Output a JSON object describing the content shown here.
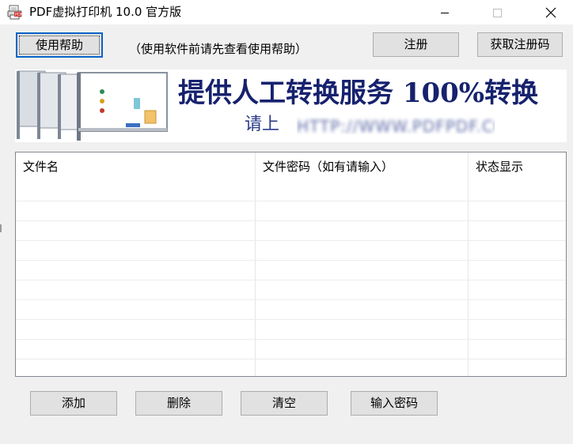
{
  "window": {
    "title": "PDF虚拟打印机 10.0 官方版",
    "app_icon": "pdf-printer-icon",
    "controls": [
      "minimize-icon",
      "maximize-icon",
      "close-icon"
    ]
  },
  "toolbar": {
    "help_label": "使用帮助",
    "hint": "（使用软件前请先查看使用帮助）",
    "register_label": "注册",
    "get_code_label": "获取注册码"
  },
  "banner": {
    "headline": "提供人工转换服务 100%转换",
    "subline": "请上",
    "url_obscured": "HTTP://WWW.PDFPDF.COM",
    "accent_color": "#16226e"
  },
  "table": {
    "columns": [
      "文件名",
      "文件密码（如有请输入）",
      "状态显示"
    ],
    "rows": []
  },
  "actions": {
    "add_label": "添加",
    "delete_label": "删除",
    "clear_label": "清空",
    "password_label": "输入密码"
  }
}
